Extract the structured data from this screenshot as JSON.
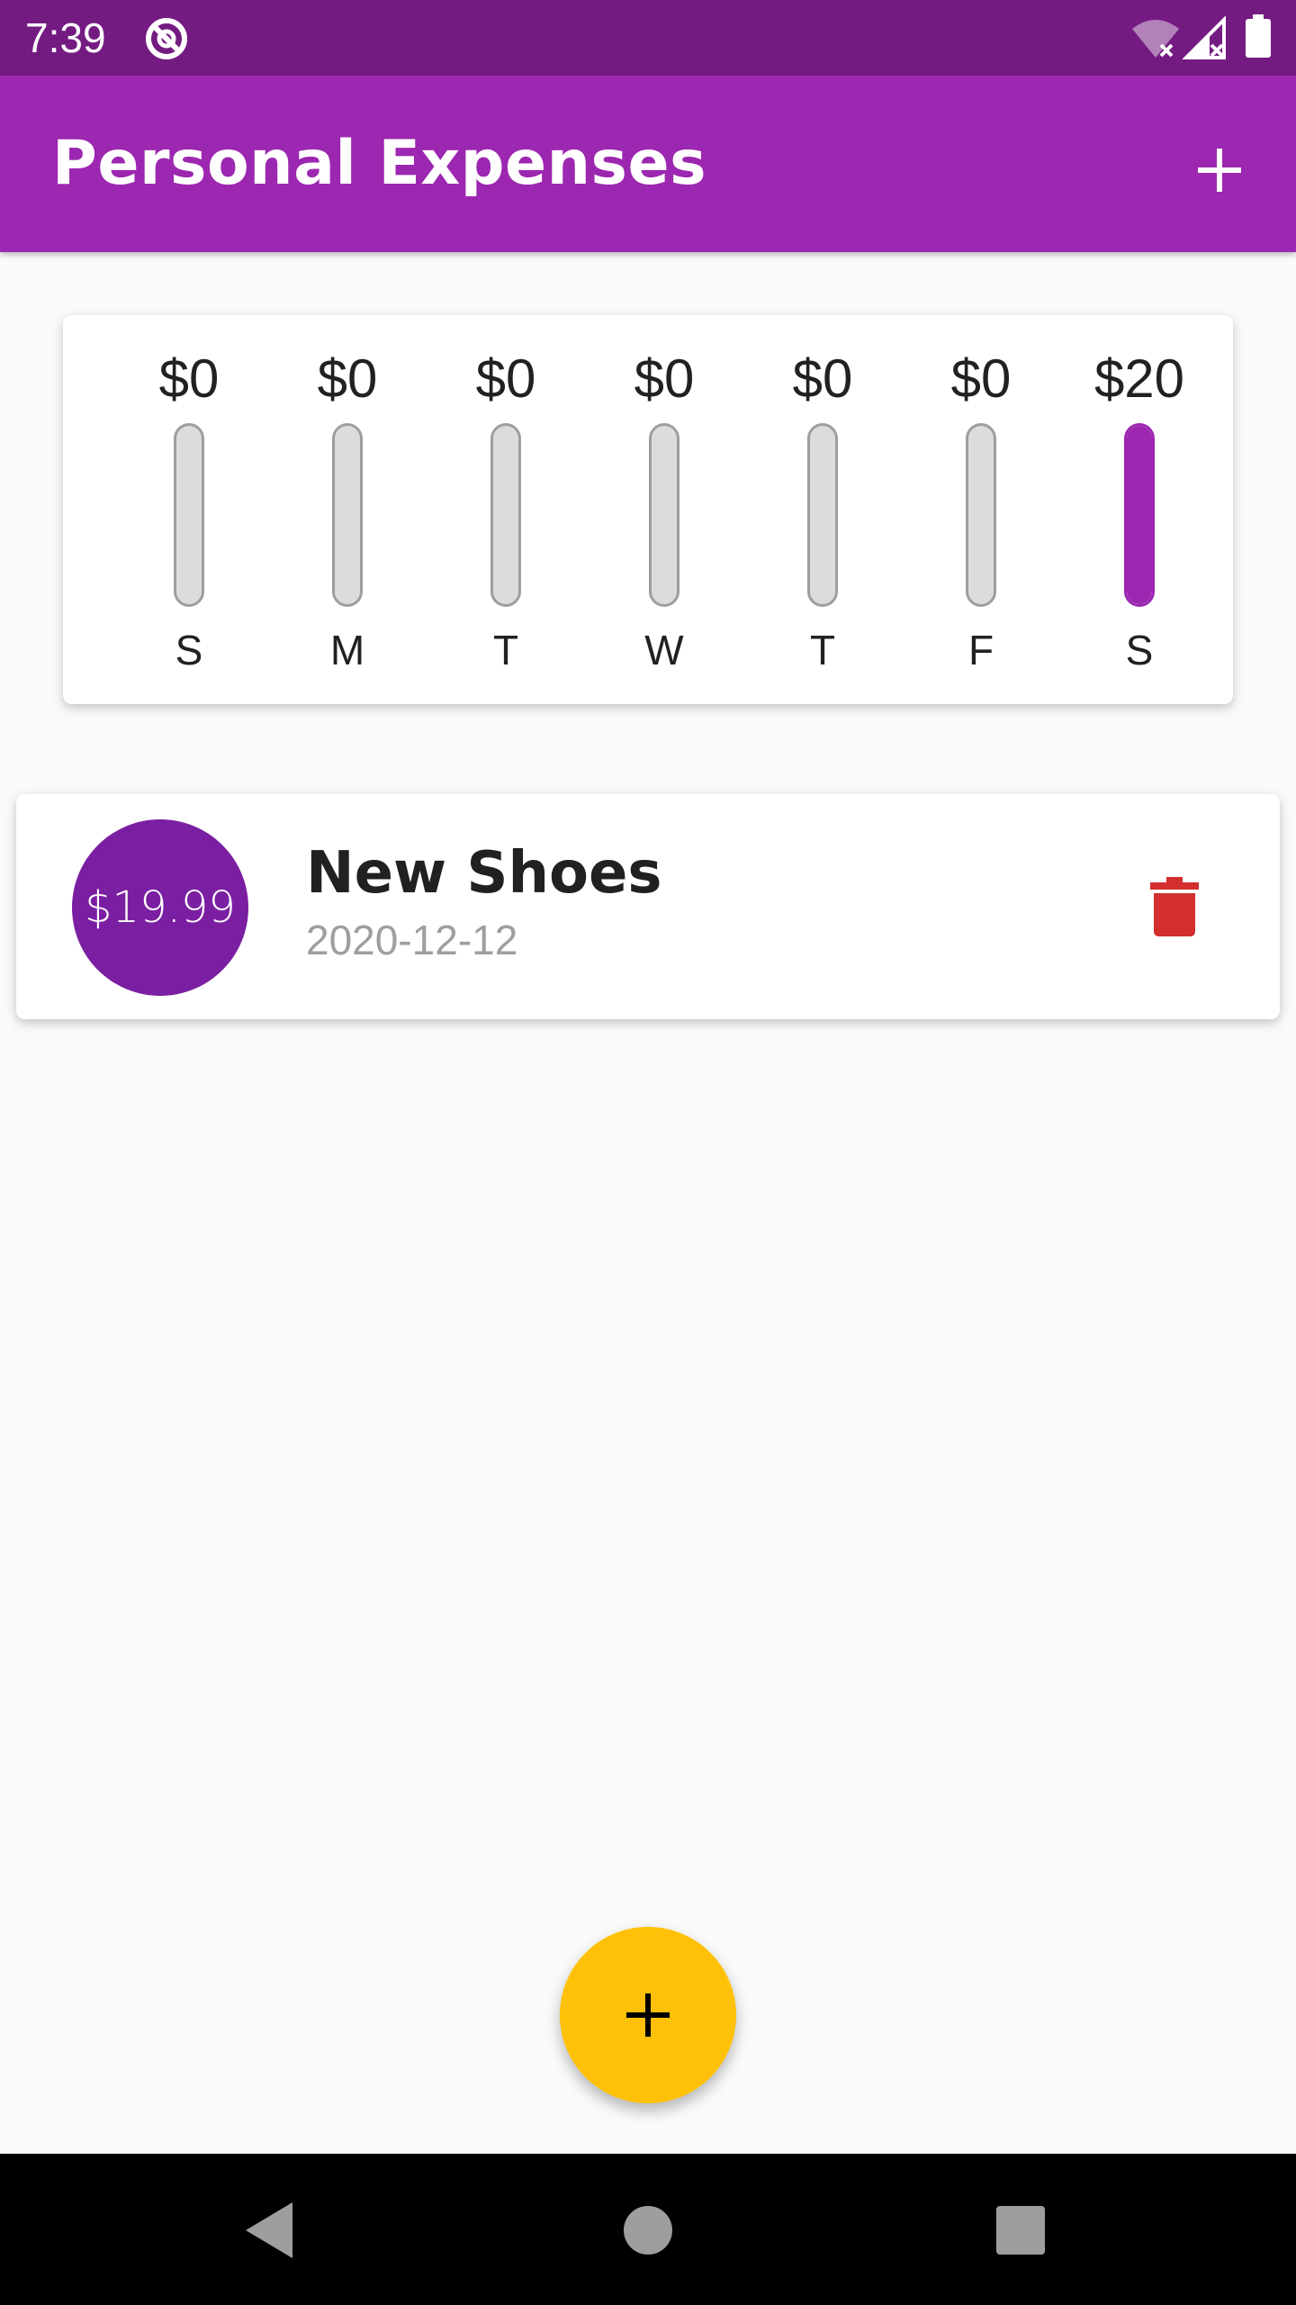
{
  "status_bar": {
    "time": "7:39",
    "icons": [
      "data-saver-icon",
      "wifi-off-icon",
      "signal-off-icon",
      "battery-icon"
    ]
  },
  "app_bar": {
    "title": "Personal Expenses",
    "add_icon": "plus-icon"
  },
  "chart": {
    "accent": "#9C27B0",
    "days": [
      {
        "day": "S",
        "amount": "$0",
        "fill": 0
      },
      {
        "day": "M",
        "amount": "$0",
        "fill": 0
      },
      {
        "day": "T",
        "amount": "$0",
        "fill": 0
      },
      {
        "day": "W",
        "amount": "$0",
        "fill": 0
      },
      {
        "day": "T",
        "amount": "$0",
        "fill": 0
      },
      {
        "day": "F",
        "amount": "$0",
        "fill": 0
      },
      {
        "day": "S",
        "amount": "$20",
        "fill": 1.0
      }
    ]
  },
  "transactions": [
    {
      "amount": "$19.99",
      "title": "New Shoes",
      "date": "2020-12-12",
      "delete_icon": "trash-icon"
    }
  ],
  "fab": {
    "icon": "plus-icon",
    "color": "#FFC107"
  },
  "nav_bar": {
    "buttons": [
      "back-icon",
      "home-icon",
      "recents-icon"
    ]
  },
  "colors": {
    "status_bar": "#741B82",
    "primary": "#9C27B0",
    "avatar": "#7B1FA2",
    "delete": "#D32F2F",
    "fab": "#FFC107"
  }
}
